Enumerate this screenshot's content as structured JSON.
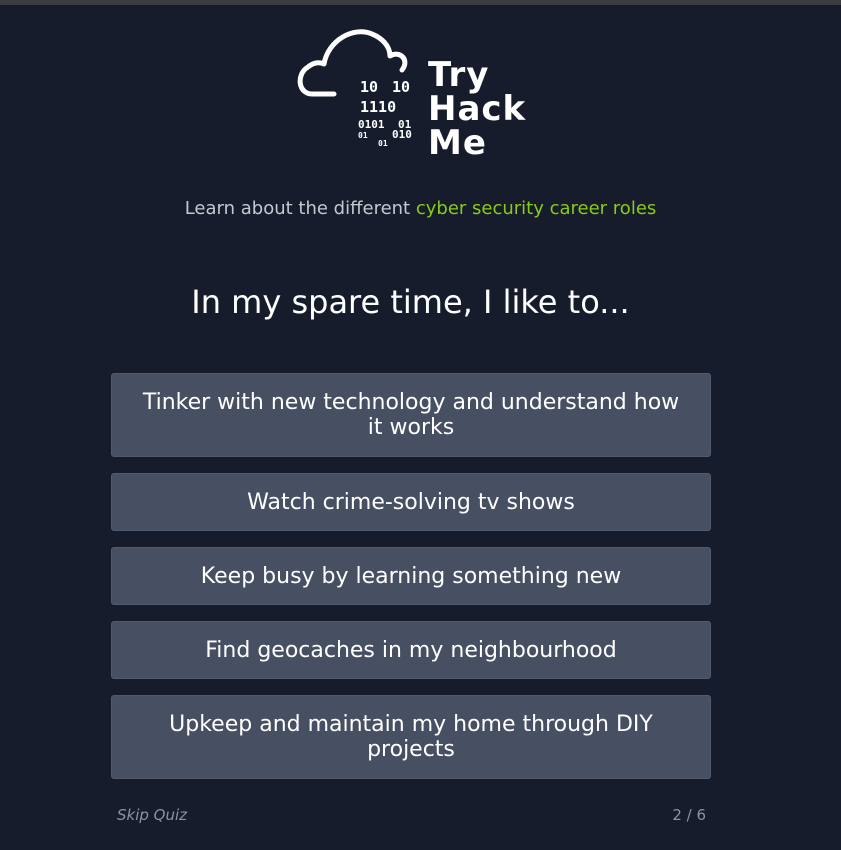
{
  "brand": {
    "logo_lines": [
      "Try",
      "Hack",
      "Me"
    ],
    "logo_binary": [
      "10",
      "10",
      "1110",
      "0101",
      "01",
      "01",
      "010",
      "01"
    ],
    "icon": "cloud-icon",
    "colors": {
      "accent": "#88cc14",
      "background": "#161c2c",
      "option": "#474f62"
    }
  },
  "intro": {
    "prefix": "Learn about the different ",
    "link": "cyber security career roles"
  },
  "question": "In my spare time, I like to...",
  "options": [
    "Tinker with new technology and understand how it works",
    "Watch crime-solving tv shows",
    "Keep busy by learning something new",
    "Find geocaches in my neighbourhood",
    "Upkeep and maintain my home through DIY projects"
  ],
  "footer": {
    "skip": "Skip Quiz",
    "progress": "2 / 6"
  }
}
